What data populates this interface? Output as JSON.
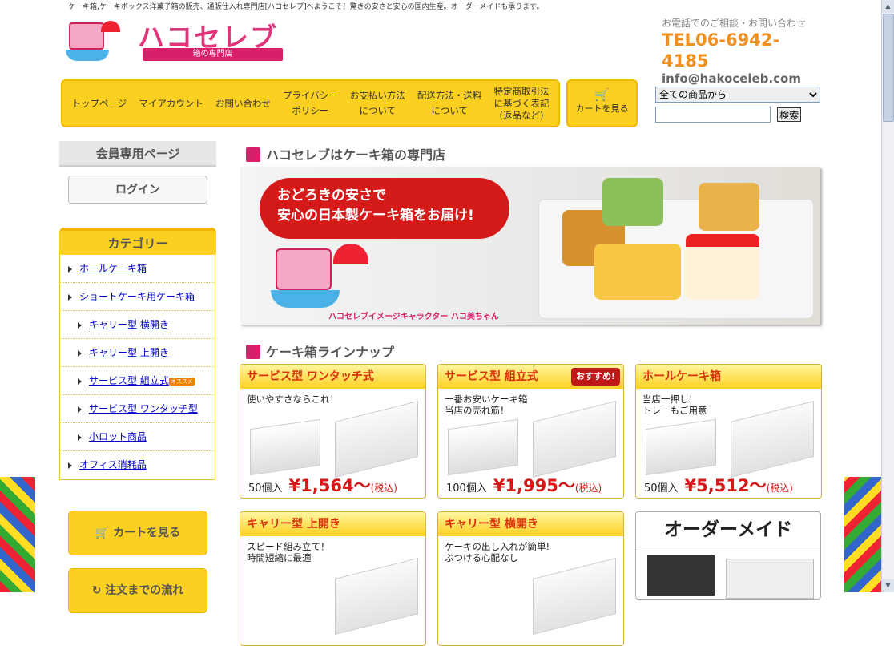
{
  "header": {
    "tagline": "ケーキ箱,ケーキボックス洋菓子箱の販売、通販仕入れ専門店[ハコセレブ]へようこそ！驚きの安さと安心の国内生産。オーダーメイドも承ります。",
    "logo_text": "ハコセレブ",
    "logo_sub": "箱の専門店",
    "contact_title": "お電話でのご相談・お問い合わせ",
    "tel": "TEL06-6942-4185",
    "email": "info@hakoceleb.com"
  },
  "nav": {
    "items": [
      {
        "line1": "トップページ",
        "line2": ""
      },
      {
        "line1": "マイアカウント",
        "line2": ""
      },
      {
        "line1": "お問い合わせ",
        "line2": ""
      },
      {
        "line1": "プライバシー",
        "line2": "ポリシー"
      },
      {
        "line1": "お支払い方法",
        "line2": "について"
      },
      {
        "line1": "配送方法・送料",
        "line2": "について"
      },
      {
        "line1": "特定商取引法",
        "line2": "に基づく表記",
        "line3": "(返品など)"
      }
    ],
    "cart": "カートを見る"
  },
  "search": {
    "selected": "全ての商品から",
    "query": "",
    "button": "検索"
  },
  "sidebar": {
    "member_title": "会員専用ページ",
    "login": "ログイン",
    "category_title": "カテゴリー",
    "categories": [
      "ホールケーキ箱",
      "ショートケーキ用ケーキ箱",
      "キャリー型 横開き",
      "キャリー型 上開き",
      "サービス型 組立式",
      "サービス型 ワンタッチ型",
      "小ロット商品",
      "オフィス消耗品"
    ],
    "category_badge": "オススメ",
    "cart_button": "カートを見る",
    "flow_button": "注文までの流れ"
  },
  "main": {
    "section1": "ハコセレブはケーキ箱の専門店",
    "hero_line1": "おどろきの安さで",
    "hero_line2": "安心の日本製ケーキ箱をお届け!",
    "hero_caption": "ハコセレブイメージキャラクター ハコ美ちゃん",
    "section2": "ケーキ箱ラインナップ",
    "products": [
      {
        "title": "サービス型 ワンタッチ式",
        "desc1": "使いやすさならこれ！",
        "desc2": "",
        "qty": "50個入",
        "price": "¥1,564～",
        "tax": "(税込)"
      },
      {
        "title": "サービス型 組立式",
        "badge": "おすすめ!",
        "desc1": "一番お安いケーキ箱",
        "desc2": "当店の売れ筋！",
        "qty": "100個入",
        "price": "¥1,995～",
        "tax": "(税込)"
      },
      {
        "title": "ホールケーキ箱",
        "desc1": "当店一押し！",
        "desc2": "トレーもご用意",
        "qty": "50個入",
        "price": "¥5,512～",
        "tax": "(税込)"
      },
      {
        "title": "キャリー型 上開き",
        "desc1": "スピード組み立て！",
        "desc2": "時間短縮に最適"
      },
      {
        "title": "キャリー型 横開き",
        "desc1": "ケーキの出し入れが簡単!",
        "desc2": "ぶつける心配なし"
      }
    ],
    "order_title": "オーダーメイド"
  }
}
